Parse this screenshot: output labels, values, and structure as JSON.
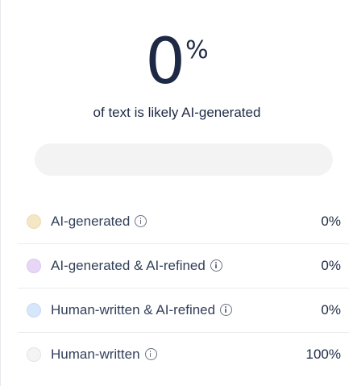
{
  "score": {
    "value": "0",
    "unit": "%",
    "caption": "of text is likely AI-generated"
  },
  "bar": {
    "ai_fraction": 0
  },
  "breakdown": [
    {
      "label": "AI-generated",
      "value": "0%",
      "color": "#f5e6c4",
      "border": "#ecdcb7"
    },
    {
      "label": "AI-generated & AI-refined",
      "value": "0%",
      "color": "#e8d6f7",
      "border": "#dcc7ef"
    },
    {
      "label": "Human-written & AI-refined",
      "value": "0%",
      "color": "#d6e6fb",
      "border": "#c6dbf6"
    },
    {
      "label": "Human-written",
      "value": "100%",
      "color": "#f4f4f5",
      "border": "#e2e3e6"
    }
  ],
  "icons": {
    "info": "info-icon"
  }
}
